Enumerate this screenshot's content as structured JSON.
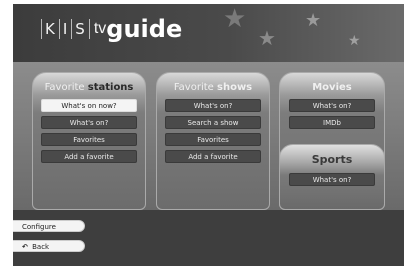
{
  "logo": {
    "k": "K",
    "i": "I",
    "s": "S",
    "tv": "tv",
    "guide": "guide"
  },
  "header": {
    "stars": [
      "★",
      "★",
      "★",
      "★"
    ]
  },
  "panels": {
    "stations": {
      "title_light": "Favorite",
      "title_bold": "stations",
      "buttons": [
        "What's on now?",
        "What's on?",
        "Favorites",
        "Add a favorite"
      ]
    },
    "shows": {
      "title_light": "Favorite",
      "title_bold": "shows",
      "buttons": [
        "What's on?",
        "Search a show",
        "Favorites",
        "Add a favorite"
      ]
    },
    "movies": {
      "title": "Movies",
      "buttons": [
        "What's on?",
        "IMDb"
      ]
    },
    "sports": {
      "title": "Sports",
      "buttons": [
        "What's on?"
      ]
    }
  },
  "footer": {
    "configure": "Configure",
    "back_arrow": "↶",
    "back": "Back"
  }
}
